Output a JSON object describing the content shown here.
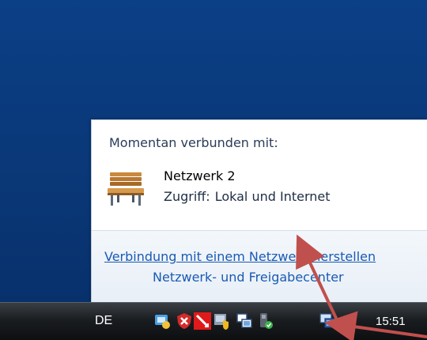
{
  "flyout": {
    "heading": "Momentan verbunden mit:",
    "network": {
      "name": "Netzwerk  2",
      "access_label": "Zugriff:",
      "access_value": "Lokal und Internet",
      "icon": "bench-network-icon"
    },
    "links": {
      "connect": "Verbindung mit einem Netzwerk herstellen",
      "center": "Netzwerk- und Freigabecenter"
    }
  },
  "taskbar": {
    "language": "DE",
    "clock": "15:51",
    "tray_icons": [
      "network-wizard-icon",
      "security-shield-icon",
      "red-warning-icon",
      "trusted-device-icon",
      "network-share-icon",
      "power-device-icon",
      "network-status-icon",
      "volume-icon"
    ]
  },
  "annotation": {
    "arrow_color": "#c0504d"
  }
}
